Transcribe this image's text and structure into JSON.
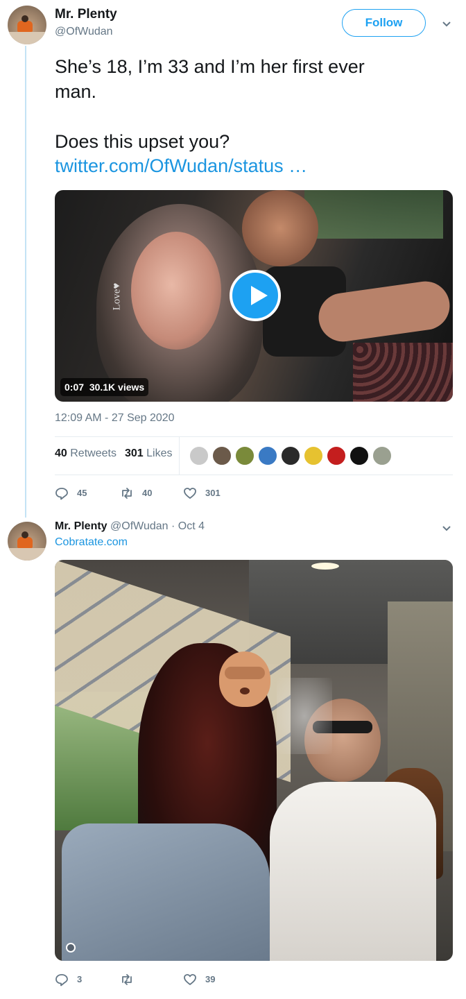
{
  "tweet1": {
    "name": "Mr. Plenty",
    "handle": "@OfWudan",
    "follow_label": "Follow",
    "text_line1": "She’s 18, I’m 33 and I’m her first ever",
    "text_line2": "man.",
    "text_line3": "Does this upset you?",
    "link": "twitter.com/OfWudan/status …",
    "video": {
      "overlay_text": "Love♥",
      "duration": "0:07",
      "views": "30.1K views"
    },
    "timestamp": "12:09 AM - 27 Sep 2020",
    "retweets_count": "40",
    "retweets_label": "Retweets",
    "likes_count": "301",
    "likes_label": "Likes",
    "likers": [
      {
        "color": "#c9c9c9"
      },
      {
        "color": "#6b5a4a"
      },
      {
        "color": "#7a8a3a"
      },
      {
        "color": "#3a7ac4"
      },
      {
        "color": "#2a2a2a"
      },
      {
        "color": "#e6c230"
      },
      {
        "color": "#c41e1e"
      },
      {
        "color": "#111111"
      },
      {
        "color": "#9aa090"
      }
    ],
    "actions": {
      "replies": "45",
      "retweets": "40",
      "likes": "301"
    }
  },
  "tweet2": {
    "name": "Mr. Plenty",
    "handle": "@OfWudan",
    "date": "· Oct 4",
    "link": "Cobratate.com",
    "actions": {
      "replies": "3",
      "retweets": "",
      "likes": "39"
    }
  },
  "colors": {
    "accent": "#1da1f2",
    "link": "#1b95e0",
    "muted": "#657786"
  }
}
